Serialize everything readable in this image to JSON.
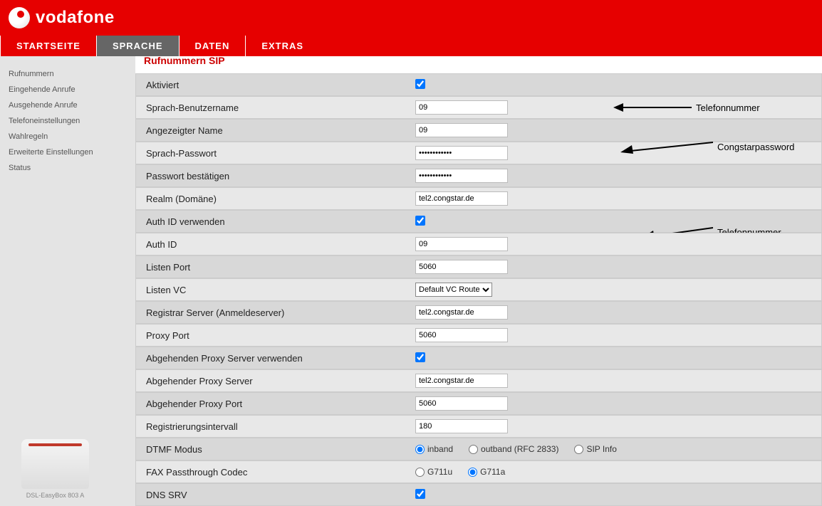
{
  "brand": "vodafone",
  "tabs": [
    "STARTSEITE",
    "SPRACHE",
    "DATEN",
    "EXTRAS"
  ],
  "active_tab": 1,
  "sidebar": {
    "items": [
      "Rufnummern",
      "Eingehende Anrufe",
      "Ausgehende Anrufe",
      "Telefoneinstellungen",
      "Wahlregeln",
      "Erweiterte Einstellungen",
      "Status"
    ],
    "device_caption": "DSL-EasyBox 803 A"
  },
  "page_title": "Rufnummern SIP",
  "rows": {
    "aktiviert": {
      "label": "Aktiviert",
      "checked": true
    },
    "sprach_user": {
      "label": "Sprach-Benutzername",
      "value": "09"
    },
    "angezeigter_name": {
      "label": "Angezeigter Name",
      "value": "09"
    },
    "sprach_pw": {
      "label": "Sprach-Passwort",
      "value": "••••••••••••"
    },
    "pw_confirm": {
      "label": "Passwort bestätigen",
      "value": "••••••••••••"
    },
    "realm": {
      "label": "Realm (Domäne)",
      "value": "tel2.congstar.de"
    },
    "auth_id_use": {
      "label": "Auth ID verwenden",
      "checked": true
    },
    "auth_id": {
      "label": "Auth ID",
      "value": "09"
    },
    "listen_port": {
      "label": "Listen Port",
      "value": "5060"
    },
    "listen_vc": {
      "label": "Listen VC",
      "selected": "Default VC Route"
    },
    "registrar": {
      "label": "Registrar Server (Anmeldeserver)",
      "value": "tel2.congstar.de"
    },
    "proxy_port": {
      "label": "Proxy Port",
      "value": "5060"
    },
    "outgoing_proxy_use": {
      "label": "Abgehenden Proxy Server verwenden",
      "checked": true
    },
    "outgoing_proxy": {
      "label": "Abgehender Proxy Server",
      "value": "tel2.congstar.de"
    },
    "outgoing_proxy_port": {
      "label": "Abgehender Proxy Port",
      "value": "5060"
    },
    "reg_interval": {
      "label": "Registrierungsintervall",
      "value": "180"
    },
    "dtmf": {
      "label": "DTMF Modus",
      "options": [
        "inband",
        "outband (RFC 2833)",
        "SIP Info"
      ],
      "selected": 0
    },
    "fax_codec": {
      "label": "FAX Passthrough Codec",
      "options": [
        "G711u",
        "G711a"
      ],
      "selected": 1
    },
    "dns_srv": {
      "label": "DNS SRV",
      "checked": true
    }
  },
  "annotations": {
    "telefonnummer": "Telefonnummer",
    "congstarpassword": "Congstarpassword"
  }
}
